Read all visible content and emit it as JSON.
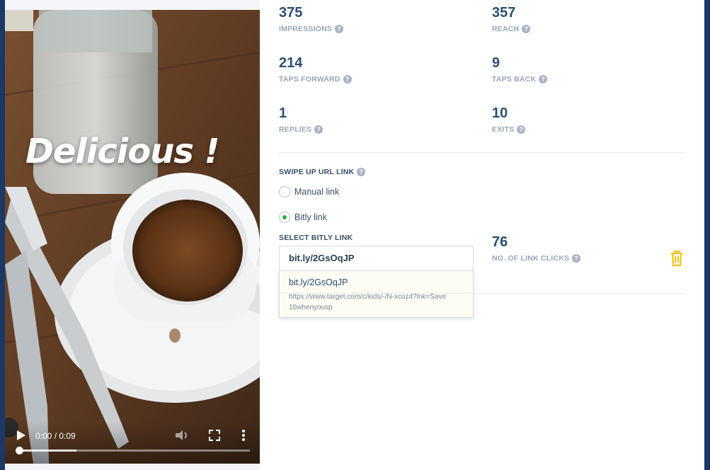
{
  "media": {
    "overlay_text": "Delicious !",
    "time_display": "0:00 / 0:09",
    "progress_fraction": 0.0,
    "buffered_fraction": 0.25
  },
  "metrics": {
    "impressions": {
      "value": "375",
      "label": "IMPRESSIONS"
    },
    "reach": {
      "value": "357",
      "label": "REACH"
    },
    "taps_forward": {
      "value": "214",
      "label": "TAPS FORWARD"
    },
    "taps_back": {
      "value": "9",
      "label": "TAPS BACK"
    },
    "replies": {
      "value": "1",
      "label": "REPLIES"
    },
    "exits": {
      "value": "10",
      "label": "EXITS"
    }
  },
  "swipe_up": {
    "title": "SWIPE UP URL LINK",
    "options": [
      {
        "label": "Manual link",
        "checked": false
      },
      {
        "label": "Bitly link",
        "checked": true
      }
    ],
    "select_label": "SELECT BITLY LINK",
    "selected_value": "bit.ly/2GsOqJP",
    "dropdown_option": {
      "short": "bit.ly/2GsOqJP",
      "long": "https://www.target.com/c/kids/-/N-xcoz4?lnk=Save10whenyousp"
    },
    "clicks": {
      "value": "76",
      "label": "NO. OF LINK CLICKS"
    }
  },
  "icons": {
    "help": "?",
    "trash_color": "#f2c200",
    "radio_checked_color": "#2eaa3d"
  }
}
